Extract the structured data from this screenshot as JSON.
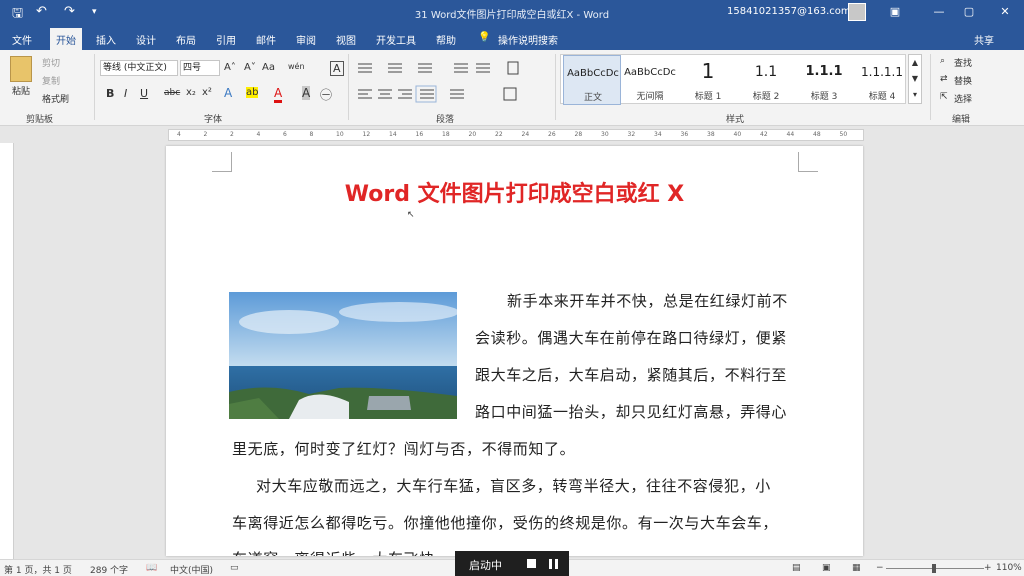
{
  "window": {
    "title": "31 Word文件图片打印成空白或红X  -  Word",
    "account": "15841021357@163.com",
    "controls": {
      "minimize": "—",
      "restore": "▢",
      "close": "✕",
      "ribbon_display": "▣"
    }
  },
  "quick_access": {
    "save": "🖫",
    "undo": "↶",
    "redo": "↷",
    "customize": "▾"
  },
  "tabs": [
    "文件",
    "开始",
    "插入",
    "设计",
    "布局",
    "引用",
    "邮件",
    "审阅",
    "视图",
    "开发工具",
    "帮助"
  ],
  "active_tab": "开始",
  "tell_me": "操作说明搜索",
  "share": "共享",
  "ribbon": {
    "clipboard": {
      "label": "剪贴板",
      "paste": "粘贴",
      "cut": "剪切",
      "copy": "复制",
      "format_painter": "格式刷"
    },
    "font": {
      "label": "字体",
      "font_name": "等线 (中文正文)",
      "font_size": "四号",
      "grow": "A˄",
      "shrink": "A˅",
      "change_case": "Aa",
      "phonetic": "wén",
      "border": "A",
      "bold": "B",
      "italic": "I",
      "underline": "U",
      "strike": "abc",
      "subscript": "x₂",
      "superscript": "x²",
      "effects": "A",
      "highlight": "ab",
      "font_color": "A",
      "shading": "A",
      "enclose": "㊀"
    },
    "paragraph": {
      "label": "段落"
    },
    "styles": {
      "label": "样式",
      "items": [
        {
          "sample": "AaBbCcDc",
          "name": "正文"
        },
        {
          "sample": "AaBbCcDc",
          "name": "无间隔"
        },
        {
          "sample": "1",
          "name": "标题 1"
        },
        {
          "sample": "1.1",
          "name": "标题 2"
        },
        {
          "sample": "1.1.1",
          "name": "标题 3"
        },
        {
          "sample": "1.1.1.1",
          "name": "标题 4"
        }
      ],
      "selected": 0
    },
    "editing": {
      "label": "编辑",
      "find": "查找",
      "replace": "替换",
      "select": "选择"
    }
  },
  "ruler_ticks": [
    "4",
    "2",
    "2",
    "4",
    "6",
    "8",
    "10",
    "12",
    "14",
    "16",
    "18",
    "20",
    "22",
    "24",
    "26",
    "28",
    "30",
    "32",
    "34",
    "36",
    "38",
    "40",
    "42",
    "44",
    "48",
    "50"
  ],
  "document": {
    "heading": "Word 文件图片打印成空白或红 X",
    "lines": [
      "新手本来开车并不快，总是在红绿灯前不",
      "会读秒。偶遇大车在前停在路口待绿灯，便紧",
      "跟大车之后，大车启动，紧随其后，不料行至",
      "路口中间猛一抬头，却只见红灯高悬，弄得心",
      "里无底，何时变了红灯？闯灯与否，不得而知了。",
      "对大车应敬而远之，大车行车猛，盲区多，转弯半径大，往往不容侵犯，小",
      "车离得近怎么都得吃亏。你撞他他撞你，受伤的终规是你。有一次与大车会车，",
      "车道窄，离得近些，大车飞快"
    ]
  },
  "status": {
    "page": "第 1 页，共 1 页",
    "words": "289 个字",
    "language": "中文(中国)",
    "zoom": "110%"
  },
  "tooltip": {
    "label": "启动中"
  },
  "colors": {
    "brand": "#2b579a",
    "heading": "#e02626",
    "ribbon_bg": "#f3f3f3"
  }
}
